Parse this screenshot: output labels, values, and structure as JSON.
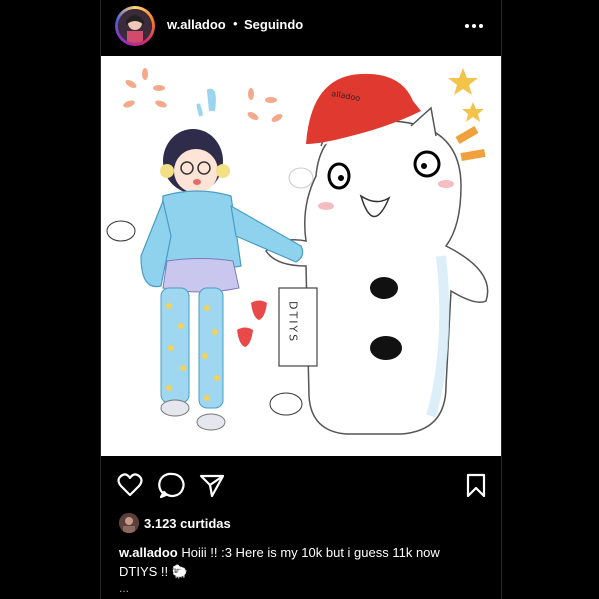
{
  "header": {
    "username": "w.alladoo",
    "separator": "•",
    "follow_label": "Seguindo"
  },
  "media": {
    "drawing_texts": [
      "DTIYS",
      "alladoo"
    ]
  },
  "actions": {
    "icons": [
      "heart-icon",
      "comment-icon",
      "share-icon",
      "bookmark-icon"
    ]
  },
  "likes": {
    "text": "3.123 curtidas"
  },
  "caption": {
    "username": "w.alladoo",
    "text": "Hoiii !! :3 Here is my 10k but i guess 11k now DTIYS !! 🐑"
  },
  "more_text": "...",
  "colors": {
    "background": "#000000",
    "story_ring": [
      "#feda75",
      "#fa7e1e",
      "#d62976",
      "#962fbf",
      "#4f5bd5"
    ]
  }
}
